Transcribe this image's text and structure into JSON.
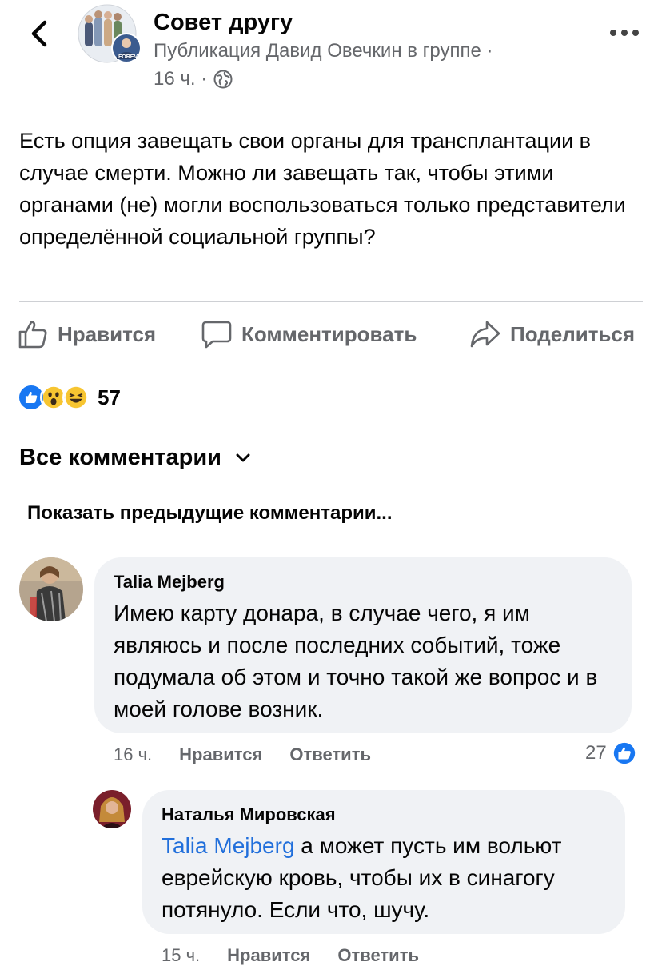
{
  "header": {
    "back_label": "back",
    "group_name": "Совет другу",
    "subtitle": "Публикация Давид Овечкин в группе ·",
    "time": "16 ч. ·",
    "avatar_badge": "FOREVER"
  },
  "post": {
    "text": "Есть опция завещать свои органы для трансплантации в случае смерти.  Можно ли завещать так, чтобы этими органами (не) могли воспользоваться только представители определённой социальной группы?"
  },
  "actions": {
    "like": "Нравится",
    "comment": "Комментировать",
    "share": "Поделиться"
  },
  "reactions": {
    "count": "57",
    "types": [
      "like-icon",
      "wow-icon",
      "haha-icon"
    ]
  },
  "comments_header": {
    "all": "Все комментарии",
    "previous": "Показать предыдущие комментарии..."
  },
  "comments": [
    {
      "author": "Talia Mejberg",
      "text": "Имею карту донара, в случае чего, я им являюсь и после последних событий, тоже подумала об этом и точно такой же вопрос и в моей голове возник.",
      "time": "16 ч.",
      "like": "Нравится",
      "reply": "Ответить",
      "likes": "27"
    },
    {
      "author": "Наталья Мировская",
      "mention": "Talia Mejberg",
      "text": " а может пусть им вольют еврейскую кровь, чтобы их в синагогу потянуло. Если что, шучу.",
      "time": "15 ч.",
      "like": "Нравится",
      "reply": "Ответить"
    }
  ],
  "colors": {
    "accent": "#1877f2",
    "mention": "#216fdb",
    "secondary_text": "#65676b",
    "bubble": "#f0f2f5"
  }
}
